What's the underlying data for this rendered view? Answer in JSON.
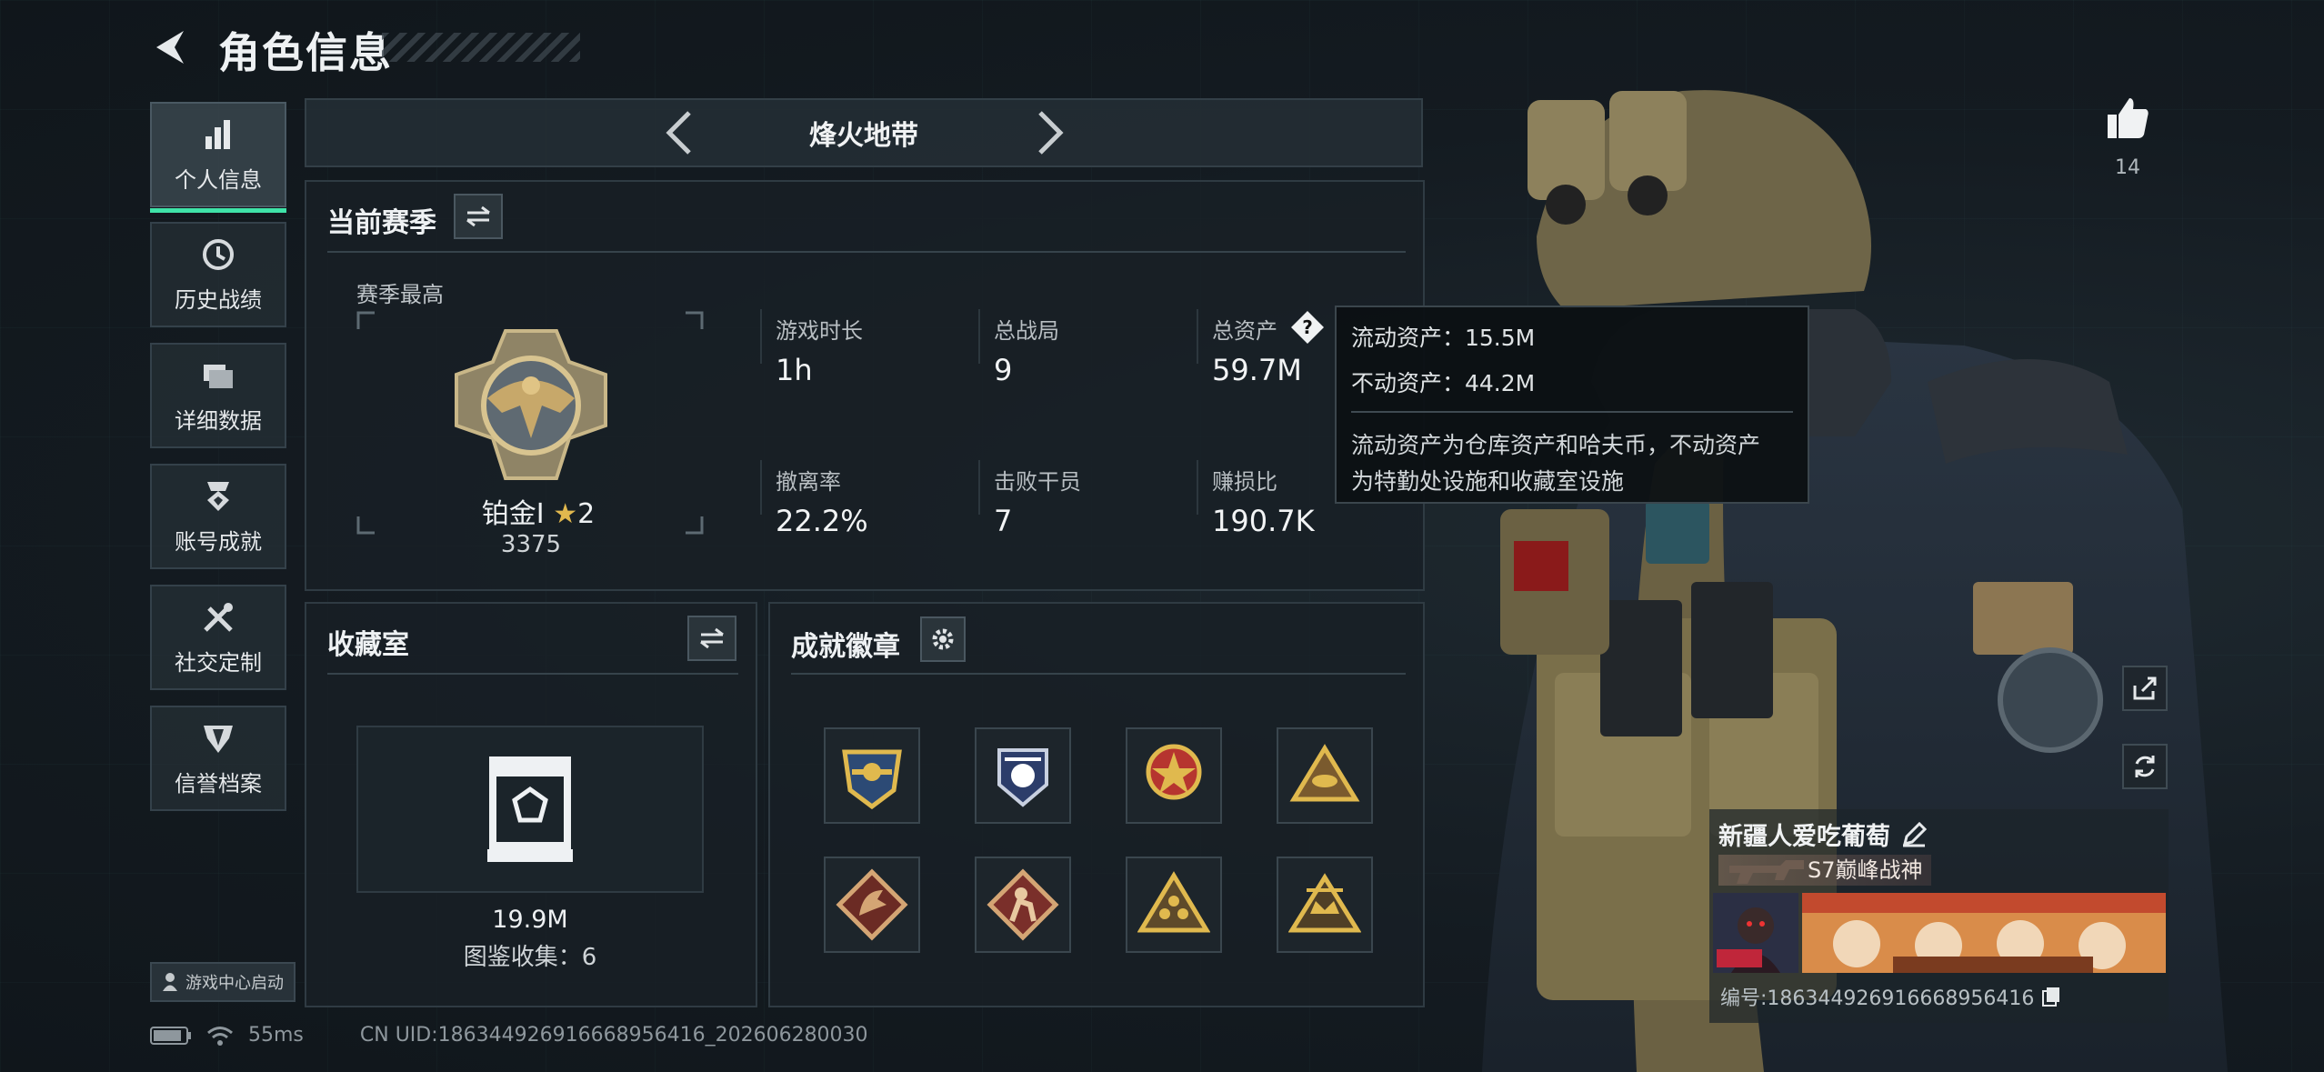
{
  "header": {
    "title": "角色信息"
  },
  "sidebar": {
    "items": [
      {
        "label": "个人信息",
        "icon": "bar-chart-icon",
        "active": true
      },
      {
        "label": "历史战绩",
        "icon": "history-clock-icon",
        "active": false
      },
      {
        "label": "详细数据",
        "icon": "folder-stack-icon",
        "active": false
      },
      {
        "label": "账号成就",
        "icon": "achievement-medal-icon",
        "active": false
      },
      {
        "label": "社交定制",
        "icon": "tools-icon",
        "active": false
      },
      {
        "label": "信誉档案",
        "icon": "shield-wing-icon",
        "active": false
      }
    ],
    "launch_label": "游戏中心启动"
  },
  "mode": {
    "title": "烽火地带"
  },
  "season": {
    "title": "当前赛季",
    "best_label": "赛季最高",
    "rank_name": "铂金I",
    "rank_stars": "2",
    "rank_score": "3375",
    "stats": [
      {
        "label": "游戏时长",
        "value": "1h"
      },
      {
        "label": "总战局",
        "value": "9"
      },
      {
        "label": "总资产",
        "value": "59.7M"
      },
      {
        "label": "撤离率",
        "value": "22.2%"
      },
      {
        "label": "击败干员",
        "value": "7"
      },
      {
        "label": "赚损比",
        "value": "190.7K"
      }
    ]
  },
  "tooltip": {
    "liquid": "流动资产：15.5M",
    "fixed": "不动资产：44.2M",
    "desc_line1": "流动资产为仓库资产和哈夫币，不动资产",
    "desc_line2": "为特勤处设施和收藏室设施"
  },
  "collection": {
    "title": "收藏室",
    "value": "19.9M",
    "count_label": "图鉴收集：6"
  },
  "achievements": {
    "title": "成就徽章",
    "badges": [
      "eagle-badge-icon",
      "police-badge-icon",
      "star-emblem-icon",
      "triangle-eye-icon",
      "dragon-badge-icon",
      "soldier-badge-icon",
      "triangle-team-icon",
      "triangle-crown-icon"
    ]
  },
  "status": {
    "ping": "55ms",
    "uid": "CN UID:18634492691666895641​6_202606280030"
  },
  "profile": {
    "likes": "14",
    "nickname": "新疆人爱吃葡萄",
    "title_tag": "S7巅峰战神",
    "id_line": "编号:18634492691666895641​6"
  },
  "colors": {
    "accent": "#3fe3a8",
    "panel": "#182026",
    "text": "#dfe3e6"
  }
}
